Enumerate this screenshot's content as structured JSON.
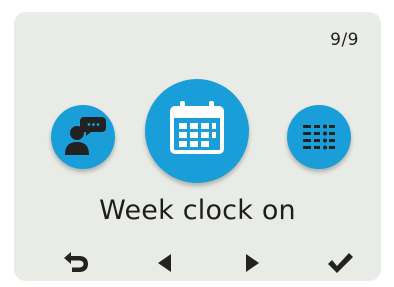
{
  "header": {
    "page_counter": "9/9"
  },
  "carousel": {
    "items": [
      {
        "icon": "user-speech-icon",
        "position": "left"
      },
      {
        "icon": "calendar-icon",
        "position": "center",
        "selected": true
      },
      {
        "icon": "list-schedule-icon",
        "position": "right"
      }
    ]
  },
  "selection": {
    "label": "Week clock on"
  },
  "navigation": [
    {
      "icon": "back-arrow-icon"
    },
    {
      "icon": "triangle-left-icon"
    },
    {
      "icon": "triangle-right-icon"
    },
    {
      "icon": "checkmark-icon"
    }
  ],
  "colors": {
    "accent": "#1a9ed9",
    "background": "#e9ece6",
    "icon_fg": "#222222"
  }
}
